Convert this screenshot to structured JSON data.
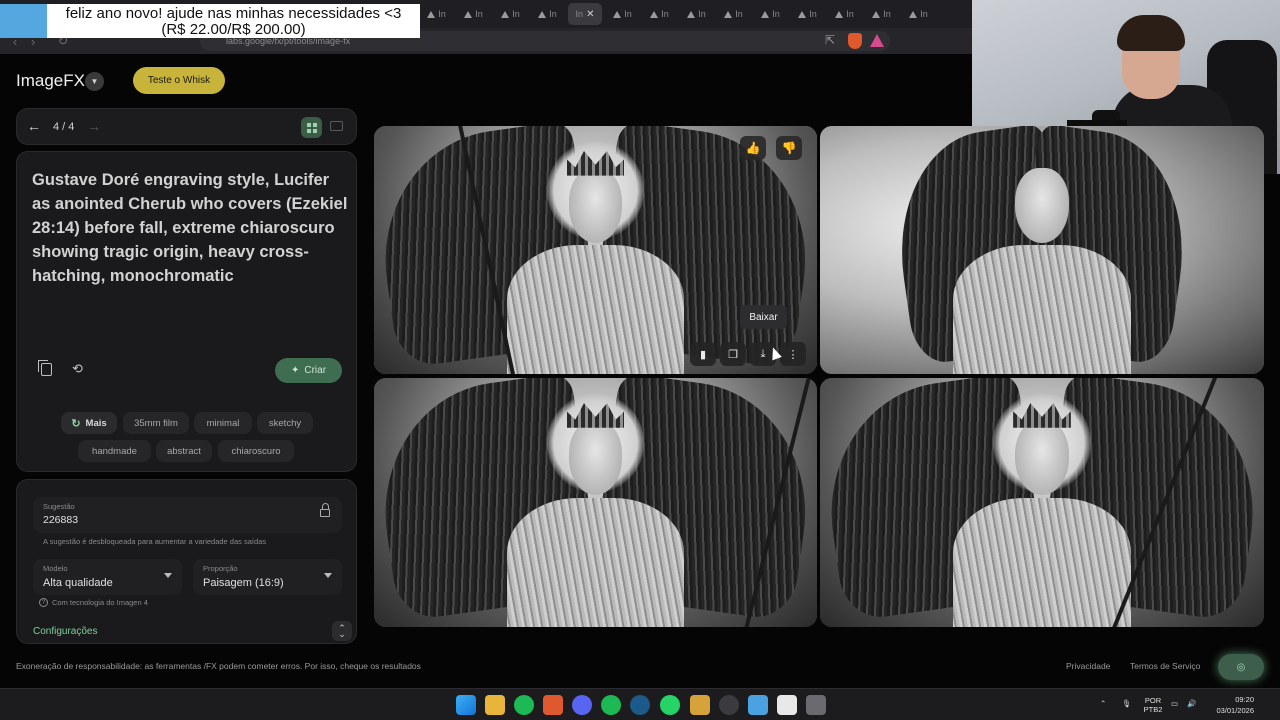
{
  "browser": {
    "tab_label": "In",
    "url": "labs.google/fx/pt/tools/image-fx"
  },
  "overlay": {
    "donation_line1": "feliz ano novo! ajude nas minhas necessidades <3",
    "donation_line2": "(R$ 22.00/R$ 200.00)"
  },
  "header": {
    "app_name": "ImageFX",
    "whisk_button": "Teste o Whisk"
  },
  "pager": {
    "count": "4 / 4"
  },
  "prompt": {
    "text": "Gustave Doré engraving style, Lucifer as anointed Cherub who covers (Ezekiel 28:14) before fall, extreme chiaroscuro showing tragic origin, heavy cross-hatching, monochromatic",
    "create_button": "Criar"
  },
  "chips": {
    "more": "Mais",
    "items": [
      "35mm film",
      "minimal",
      "sketchy",
      "handmade",
      "abstract",
      "chiaroscuro"
    ]
  },
  "settings": {
    "seed_label": "Sugestão",
    "seed_value": "226883",
    "seed_hint": "A sugestão é desbloqueada para aumentar a variedade das saídas",
    "model_label": "Modelo",
    "model_value": "Alta qualidade",
    "ratio_label": "Proporção",
    "ratio_value": "Paisagem (16:9)",
    "powered_by": "Com tecnologia do Imagen 4",
    "config_link": "Configurações"
  },
  "image_tooltip": "Baixar",
  "footer": {
    "disclaimer": "Exoneração de responsabilidade: as ferramentas /FX podem cometer erros. Por isso, cheque os resultados",
    "privacy": "Privacidade",
    "terms": "Termos de Serviço"
  },
  "taskbar": {
    "lang_line1": "POR",
    "lang_line2": "PTB2",
    "time": "09:20",
    "date": "03/01/2026"
  },
  "colors": {
    "accent_green": "#5f9e73",
    "whisk_yellow": "#c8b43a",
    "create_green": "#3f6d52"
  }
}
